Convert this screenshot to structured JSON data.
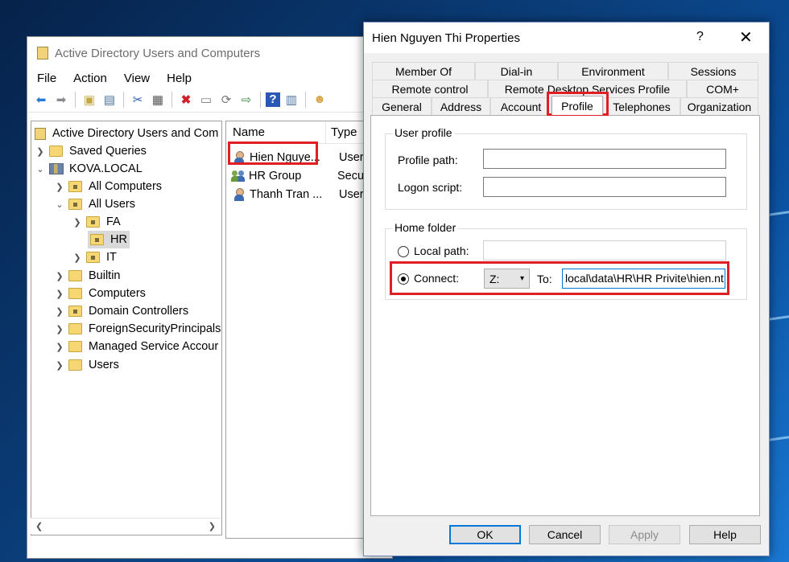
{
  "aduc": {
    "title": "Active Directory Users and Computers",
    "menu": [
      "File",
      "Action",
      "View",
      "Help"
    ],
    "tree": {
      "root": "Active Directory Users and Com",
      "saved_queries": "Saved Queries",
      "domain": "KOVA.LOCAL",
      "all_computers": "All Computers",
      "all_users": "All Users",
      "fa": "FA",
      "hr": "HR",
      "it": "IT",
      "builtin": "Builtin",
      "computers": "Computers",
      "domain_controllers": "Domain Controllers",
      "fsp": "ForeignSecurityPrincipals",
      "msa": "Managed Service Accour",
      "users": "Users"
    },
    "list": {
      "col_name": "Name",
      "col_type": "Type",
      "rows": [
        {
          "name": "Hien Nguye...",
          "type": "User"
        },
        {
          "name": "HR Group",
          "type": "Securi"
        },
        {
          "name": "Thanh Tran ...",
          "type": "User"
        }
      ]
    }
  },
  "dialog": {
    "title": "Hien Nguyen Thi Properties",
    "help": "?",
    "close": "✕",
    "tabs": {
      "member_of": "Member Of",
      "dial_in": "Dial-in",
      "environment": "Environment",
      "sessions": "Sessions",
      "remote_control": "Remote control",
      "rdsp": "Remote Desktop Services Profile",
      "com": "COM+",
      "general": "General",
      "address": "Address",
      "account": "Account",
      "profile": "Profile",
      "telephones": "Telephones",
      "organization": "Organization"
    },
    "user_profile": {
      "legend": "User profile",
      "profile_path_label": "Profile path:",
      "profile_path_value": "",
      "logon_script_label": "Logon script:",
      "logon_script_value": ""
    },
    "home_folder": {
      "legend": "Home folder",
      "local_path_label": "Local path:",
      "local_path_value": "",
      "connect_label": "Connect:",
      "drive": "Z:",
      "to_label": "To:",
      "to_value": "local\\data\\HR\\HR Privite\\hien.nt"
    },
    "buttons": {
      "ok": "OK",
      "cancel": "Cancel",
      "apply": "Apply",
      "help": "Help"
    }
  },
  "highlight_color": "#e01e26"
}
